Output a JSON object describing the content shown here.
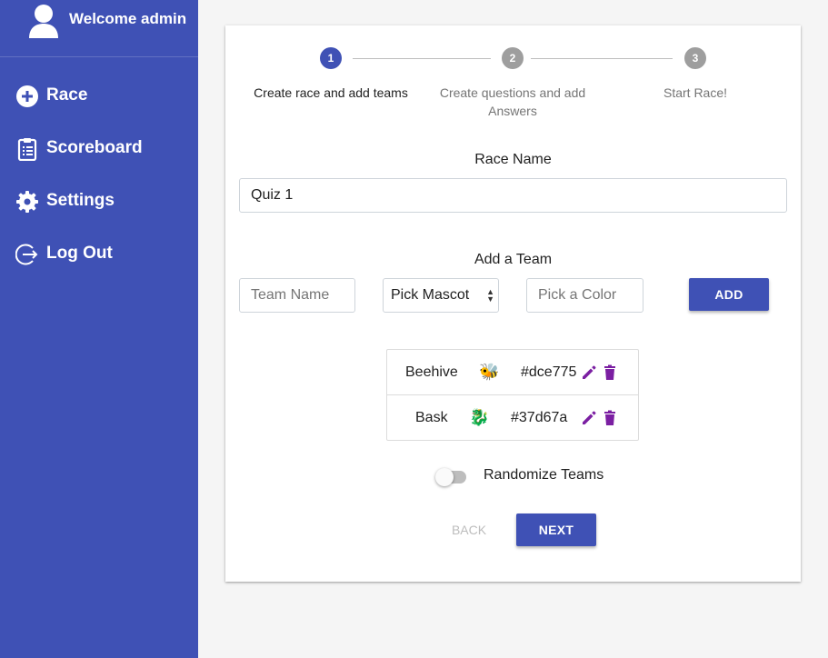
{
  "colors": {
    "primary": "#3f51b5",
    "inactive_step": "#9e9e9e",
    "action_icon": "#7b1fa2",
    "background": "#f5f5f5"
  },
  "sidebar": {
    "welcome": "Welcome admin",
    "avatar_icon": "user-icon",
    "items": [
      {
        "label": "Race",
        "icon": "plus-circle-icon"
      },
      {
        "label": "Scoreboard",
        "icon": "clipboard-icon"
      },
      {
        "label": "Settings",
        "icon": "gear-icon"
      },
      {
        "label": "Log Out",
        "icon": "logout-icon"
      }
    ]
  },
  "stepper": {
    "active_step": 1,
    "steps": [
      {
        "number": "1",
        "label": "Create race and add teams"
      },
      {
        "number": "2",
        "label": "Create questions and add Answers"
      },
      {
        "number": "3",
        "label": "Start Race!"
      }
    ]
  },
  "race_name": {
    "label": "Race Name",
    "value": "Quiz 1"
  },
  "add_team": {
    "label": "Add a Team",
    "team_name_placeholder": "Team Name",
    "mascot_selected": "Pick Mascot",
    "color_placeholder": "Pick a Color",
    "add_button": "ADD"
  },
  "teams": [
    {
      "name": "Beehive",
      "mascot": "🐝",
      "mascot_icon": "bee-icon",
      "color": "#dce775"
    },
    {
      "name": "Bask",
      "mascot": "🐉",
      "mascot_icon": "dragon-icon",
      "color": "#37d67a"
    }
  ],
  "randomize": {
    "label": "Randomize Teams",
    "enabled": false
  },
  "nav_buttons": {
    "back": "BACK",
    "next": "NEXT"
  }
}
